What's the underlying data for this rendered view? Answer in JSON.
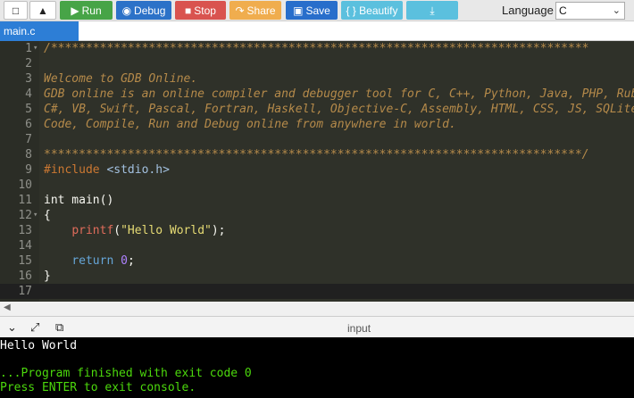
{
  "toolbar": {
    "run_label": "Run",
    "debug_label": "Debug",
    "stop_label": "Stop",
    "share_label": "Share",
    "save_label": "Save",
    "beautify_label": "{ } Beautify",
    "language_label": "Language",
    "language_value": "C",
    "icons": [
      "new-file-icon",
      "upload-icon",
      "play-icon",
      "debug-icon",
      "stop-icon",
      "share-icon",
      "save-icon",
      "download-icon",
      "chevron-down-icon"
    ]
  },
  "tab": {
    "label": "main.c"
  },
  "editor": {
    "lines": [
      {
        "n": "1",
        "t": "/*****************************************************************************"
      },
      {
        "n": "2",
        "t": ""
      },
      {
        "n": "3",
        "t": "Welcome to GDB Online."
      },
      {
        "n": "4",
        "t": "GDB online is an online compiler and debugger tool for C, C++, Python, Java, PHP, Ruby, Perl,"
      },
      {
        "n": "5",
        "t": "C#, VB, Swift, Pascal, Fortran, Haskell, Objective-C, Assembly, HTML, CSS, JS, SQLite, Prolog."
      },
      {
        "n": "6",
        "t": "Code, Compile, Run and Debug online from anywhere in world."
      },
      {
        "n": "7",
        "t": ""
      },
      {
        "n": "8",
        "t": "*****************************************************************************/"
      },
      {
        "n": "9",
        "t": "#include <stdio.h>"
      },
      {
        "n": "10",
        "t": ""
      },
      {
        "n": "11",
        "t": "int main()"
      },
      {
        "n": "12",
        "t": "{"
      },
      {
        "n": "13",
        "t": "    printf(\"Hello World\");"
      },
      {
        "n": "14",
        "t": ""
      },
      {
        "n": "15",
        "t": "    return 0;"
      },
      {
        "n": "16",
        "t": "}"
      },
      {
        "n": "17",
        "t": ""
      }
    ],
    "tokens": {
      "include_kw": "#include",
      "include_hdr": "<stdio.h>",
      "int_main": "int main()",
      "brace_open": "{",
      "printf_fn": "printf",
      "printf_open": "(",
      "printf_str": "\"Hello World\"",
      "printf_close": ");",
      "return_kw": "return",
      "return_val": "0",
      "return_semi": ";",
      "brace_close": "}"
    }
  },
  "console": {
    "header_label": "input",
    "icons": [
      "chevron-down-icon",
      "expand-icon",
      "copy-icon"
    ],
    "output_line": "Hello World",
    "finished_line": "...Program finished with exit code 0",
    "enter_line": "Press ENTER to exit console."
  }
}
